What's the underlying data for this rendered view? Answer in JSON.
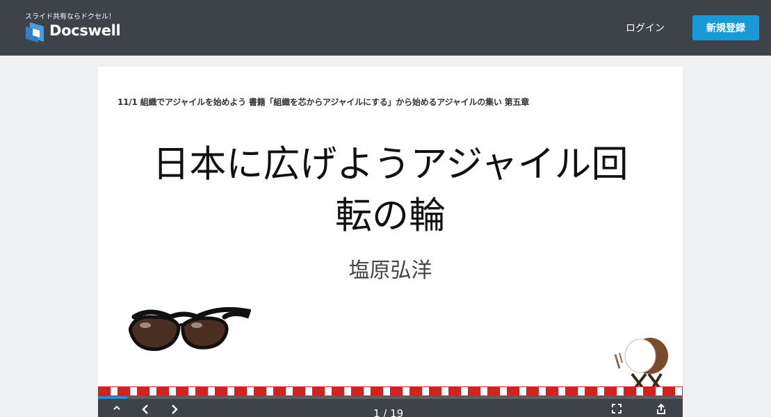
{
  "header": {
    "tagline": "スライド共有ならドクセル！",
    "logo_text": "Docswell",
    "login_label": "ログイン",
    "signup_label": "新規登録",
    "colors": {
      "bar": "#3e4249",
      "signup": "#199ad8"
    }
  },
  "slide": {
    "header_text": "11/1 組織でアジャイルを始めよう 書籍「組織を芯からアジャイルにする」から始めるアジャイルの集い 第五章",
    "title_line1": "日本に広げようアジャイル回",
    "title_line2": "転の輪",
    "author": "塩原弘洋",
    "images": [
      "sunglasses",
      "taiko-drum"
    ]
  },
  "viewer": {
    "page_current": 1,
    "page_total": 19,
    "page_indicator": "1 / 19",
    "progress": 0.05,
    "icons": [
      "chevron-up-icon",
      "prev-icon",
      "next-icon",
      "fullscreen-icon",
      "share-icon"
    ]
  }
}
